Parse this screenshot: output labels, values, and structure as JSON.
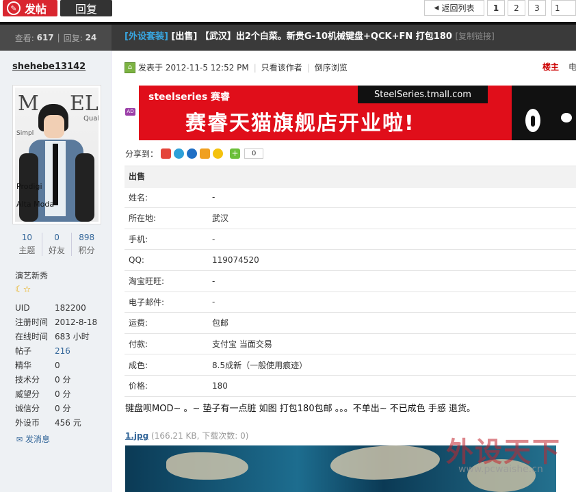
{
  "toolbar": {
    "post_label": "发帖",
    "reply_label": "回复",
    "back_label": "返回列表",
    "pages": [
      "1",
      "2",
      "3"
    ],
    "page_input": "1"
  },
  "thread": {
    "views_label": "查看:",
    "views": "617",
    "replies_label": "回复:",
    "replies": "24",
    "category": "[外设套装]",
    "title_rest": "[出售] 【武汉】出2个白菜。新贵G-10机械键盘+QCK+FN 打包180",
    "copy_link": "[复制链接]"
  },
  "author": {
    "username": "shehebe13142",
    "counts": [
      {
        "value": "10",
        "label": "主题"
      },
      {
        "value": "0",
        "label": "好友"
      },
      {
        "value": "898",
        "label": "积分"
      }
    ],
    "rank": "演艺新秀",
    "info": [
      {
        "k": "UID",
        "v": "182200"
      },
      {
        "k": "注册时间",
        "v": "2012-8-18"
      },
      {
        "k": "在线时间",
        "v": "683 小时"
      },
      {
        "k": "帖子",
        "v": "216"
      },
      {
        "k": "精华",
        "v": "0"
      },
      {
        "k": "技术分",
        "v": "0 分"
      },
      {
        "k": "威望分",
        "v": "0 分"
      },
      {
        "k": "诚信分",
        "v": "0 分"
      },
      {
        "k": "外设币",
        "v": "456 元"
      }
    ],
    "message_label": "发消息",
    "avatar_text_1": "M",
    "avatar_text_2": "EL",
    "avatar_text_3": "Quali",
    "avatar_text_4": "Simpl",
    "avatar_text_5": "Prodigi",
    "avatar_text_6": "Alta Moda"
  },
  "post": {
    "posted_label": "发表于",
    "posted_time": "2012-11-5 12:52 PM",
    "only_author": "只看该作者",
    "reverse": "倒序浏览",
    "floor_label": "楼主",
    "floor_extra": "电",
    "ad_badge": "AD",
    "banner_brand": "steelseries 赛睿",
    "banner_url": "SteelSeries.tmall.com",
    "banner_head": "赛睿天猫旗舰店开业啦!",
    "share_label": "分享到：",
    "share_count": "0",
    "table_header": "出售",
    "table": [
      {
        "k": "姓名:",
        "v": "-"
      },
      {
        "k": "所在地:",
        "v": "武汉"
      },
      {
        "k": "手机:",
        "v": "-"
      },
      {
        "k": "QQ:",
        "v": "119074520"
      },
      {
        "k": "淘宝旺旺:",
        "v": "-"
      },
      {
        "k": "电子邮件:",
        "v": "-"
      },
      {
        "k": "运费:",
        "v": "包邮"
      },
      {
        "k": "付款:",
        "v": "支付宝 当面交易"
      },
      {
        "k": "成色:",
        "v": "8.5成新（一般使用痕迹）"
      },
      {
        "k": "价格:",
        "v": "180"
      }
    ],
    "body": "键盘呗MOD~   。~   垫子有一点脏     如图  打包180包邮 。。。不单出~   不已成色  手感  退货。",
    "attachment_name": "1.jpg",
    "attachment_meta": "(166.21 KB, 下载次数: 0)",
    "watermark": "外设天下",
    "watermark_url": "www.pcwaishe.cn"
  },
  "colors": {
    "accent_red": "#d9262f",
    "link_blue": "#336699",
    "category_blue": "#38a6e0",
    "threadbar": "#3a3a3a"
  }
}
